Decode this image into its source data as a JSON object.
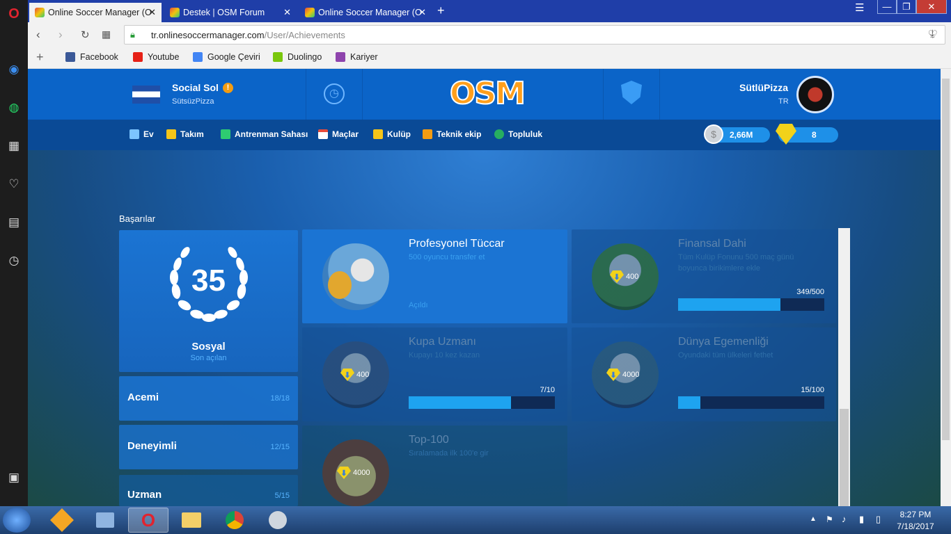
{
  "browser": {
    "tabs": [
      {
        "label": "Online Soccer Manager (O"
      },
      {
        "label": "Destek | OSM Forum"
      },
      {
        "label": "Online Soccer Manager (O"
      }
    ],
    "url_domain": "tr.onlinesoccermanager.com",
    "url_path": "/User/Achievements",
    "bookmarks": [
      {
        "label": "Facebook",
        "color": "#3b5998"
      },
      {
        "label": "Youtube",
        "color": "#e62117"
      },
      {
        "label": "Google Çeviri",
        "color": "#4285f4"
      },
      {
        "label": "Duolingo",
        "color": "#7ac70c"
      },
      {
        "label": "Kariyer",
        "color": "#8e44ad"
      }
    ]
  },
  "header": {
    "club_name": "Social Sol",
    "club_sub": "SütsüzPizza",
    "logo": "OSM",
    "user_name": "SütlüPizza",
    "user_country": "TR"
  },
  "nav": {
    "items": [
      {
        "label": "Ev"
      },
      {
        "label": "Takım"
      },
      {
        "label": "Antrenman Sahası"
      },
      {
        "label": "Maçlar"
      },
      {
        "label": "Kulüp"
      },
      {
        "label": "Teknik ekip"
      },
      {
        "label": "Topluluk"
      }
    ],
    "money": "2,66M",
    "boss_coins": "8"
  },
  "page": {
    "title": "Başarılar",
    "total_count": "35",
    "category_name": "Sosyal",
    "category_sub": "Son açılan",
    "categories": [
      {
        "name": "Acemi",
        "progress": "18/18"
      },
      {
        "name": "Deneyimli",
        "progress": "12/15"
      },
      {
        "name": "Uzman",
        "progress": "5/15"
      }
    ]
  },
  "achievements": [
    {
      "title": "Profesyonel Tüccar",
      "desc": "500 oyuncu transfer et",
      "status": "Açıldı",
      "unlocked": true
    },
    {
      "title": "Finansal Dahi",
      "desc": "Tüm Kulüp Fonunu 500 maç günü boyunca birikimlere ekle",
      "reward": "400",
      "progress_text": "349/500",
      "progress": 0.698
    },
    {
      "title": "Kupa Uzmanı",
      "desc": "Kupayı 10 kez kazan",
      "reward": "400",
      "progress_text": "7/10",
      "progress": 0.7
    },
    {
      "title": "Dünya Egemenliği",
      "desc": "Oyundaki tüm ülkeleri fethet",
      "reward": "4000",
      "progress_text": "15/100",
      "progress": 0.15
    },
    {
      "title": "Top-100",
      "desc": "Sıralamada ilk 100'e gir",
      "reward": "4000"
    }
  ],
  "taskbar": {
    "time": "8:27 PM",
    "date": "7/18/2017"
  }
}
